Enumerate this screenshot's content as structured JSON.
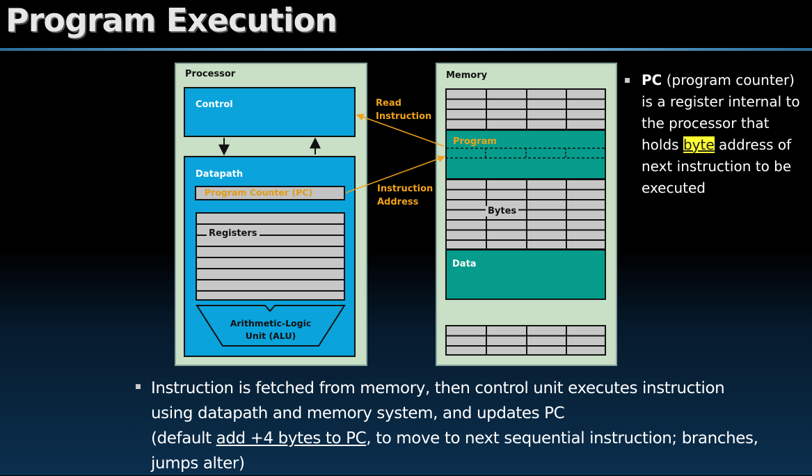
{
  "title": "Program Execution",
  "diagram": {
    "processor": {
      "label": "Processor",
      "control": "Control",
      "datapath": "Datapath",
      "pc": "Program Counter (PC)",
      "registers": "Registers",
      "alu_line1": "Arithmetic-Logic",
      "alu_line2": "Unit (ALU)"
    },
    "memory": {
      "label": "Memory",
      "program": "Program",
      "bytes": "Bytes",
      "data": "Data"
    },
    "arrows": {
      "read_line1": "Read",
      "read_line2": "Instruction",
      "addr_line1": "Instruction",
      "addr_line2": "Address"
    }
  },
  "side_bullet": {
    "bold": "PC",
    "line1_rest": " (program counter)",
    "line2": "is a register internal to",
    "line3": "the processor that",
    "line4_pre": "holds ",
    "line4_highlight": "byte",
    "line4_post": " address of",
    "line5": "next instruction to be",
    "line6": "executed"
  },
  "bottom_bullet": {
    "line1": "Instruction is fetched from memory, then control unit executes instruction",
    "line2": "using datapath and memory system, and updates PC",
    "line3_pre": "(default ",
    "line3_underline": "add +4 bytes to PC",
    "line3_post": ", to move to next sequential instruction; branches,",
    "line4": "jumps alter)"
  },
  "colors": {
    "panel": "#c9dfc6",
    "control_blue": "#0aa3dc",
    "memory_teal": "#069c8c",
    "arrow_orange": "#f0a21a",
    "highlight_yellow": "#ffff33"
  }
}
